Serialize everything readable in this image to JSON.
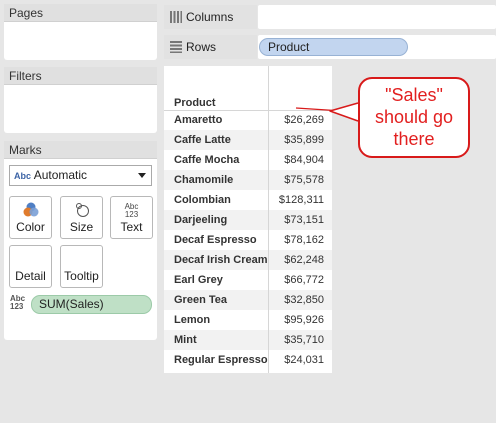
{
  "pages": {
    "title": "Pages"
  },
  "filters": {
    "title": "Filters"
  },
  "marks": {
    "title": "Marks",
    "mark_type": {
      "badge": "Abc",
      "value": "Automatic"
    },
    "buttons": [
      {
        "label": "Color",
        "icon": "color-icon"
      },
      {
        "label": "Size",
        "icon": "size-icon"
      },
      {
        "label": "Text",
        "icon": "text-icon"
      },
      {
        "label": "Detail",
        "icon": "detail-icon"
      },
      {
        "label": "Tooltip",
        "icon": "tooltip-icon"
      }
    ],
    "text_icon_glyph_top": "Abc",
    "text_icon_glyph_bottom": "123",
    "field_badge_top": "Abc",
    "field_badge_bottom": "123",
    "field_pill": "SUM(Sales)"
  },
  "shelves": {
    "columns": {
      "label": "Columns",
      "pills": []
    },
    "rows": {
      "label": "Rows",
      "pills": [
        "Product"
      ]
    }
  },
  "view": {
    "column_header": "Product",
    "rows": [
      {
        "product": "Amaretto",
        "sales": "$26,269"
      },
      {
        "product": "Caffe Latte",
        "sales": "$35,899"
      },
      {
        "product": "Caffe Mocha",
        "sales": "$84,904"
      },
      {
        "product": "Chamomile",
        "sales": "$75,578"
      },
      {
        "product": "Colombian",
        "sales": "$128,311"
      },
      {
        "product": "Darjeeling",
        "sales": "$73,151"
      },
      {
        "product": "Decaf Espresso",
        "sales": "$78,162"
      },
      {
        "product": "Decaf Irish Cream",
        "sales": "$62,248"
      },
      {
        "product": "Earl Grey",
        "sales": "$66,772"
      },
      {
        "product": "Green Tea",
        "sales": "$32,850"
      },
      {
        "product": "Lemon",
        "sales": "$95,926"
      },
      {
        "product": "Mint",
        "sales": "$35,710"
      },
      {
        "product": "Regular Espresso",
        "sales": "$24,031"
      }
    ]
  },
  "callout": {
    "lines": [
      "\"Sales\"",
      "should go",
      "there"
    ],
    "color": "#d81a1a"
  },
  "colors": {
    "rows_pill": "#c2d5ef",
    "measure_pill": "#bfe0c6"
  }
}
